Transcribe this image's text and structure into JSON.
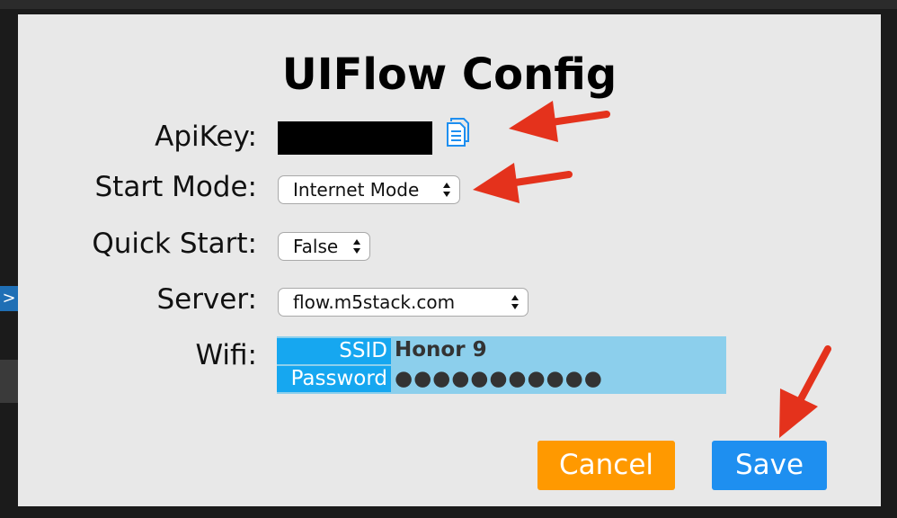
{
  "dialog": {
    "title": "UIFlow Config",
    "labels": {
      "apikey": "ApiKey:",
      "start_mode": "Start Mode:",
      "quick_start": "Quick Start:",
      "server": "Server:",
      "wifi": "Wifi:"
    },
    "start_mode": {
      "selected": "Internet Mode"
    },
    "quick_start": {
      "selected": "False"
    },
    "server": {
      "selected": "flow.m5stack.com"
    },
    "wifi": {
      "ssid_label": "SSID",
      "ssid_value": "Honor 9",
      "password_label": "Password",
      "password_value": "●●●●●●●●●●●"
    },
    "buttons": {
      "cancel": "Cancel",
      "save": "Save"
    }
  },
  "background": {
    "chevron": ">"
  },
  "colors": {
    "annotation_arrow": "#e4321c",
    "cancel_button": "#ff9900",
    "save_button": "#1e8ff0",
    "wifi_key_cell": "#16a7f0",
    "wifi_value_cell": "#8ccfec",
    "copy_icon": "#1e8ff0"
  },
  "icons": {
    "copy": "copy-document-icon",
    "select_arrows": "updown-arrows-icon"
  }
}
